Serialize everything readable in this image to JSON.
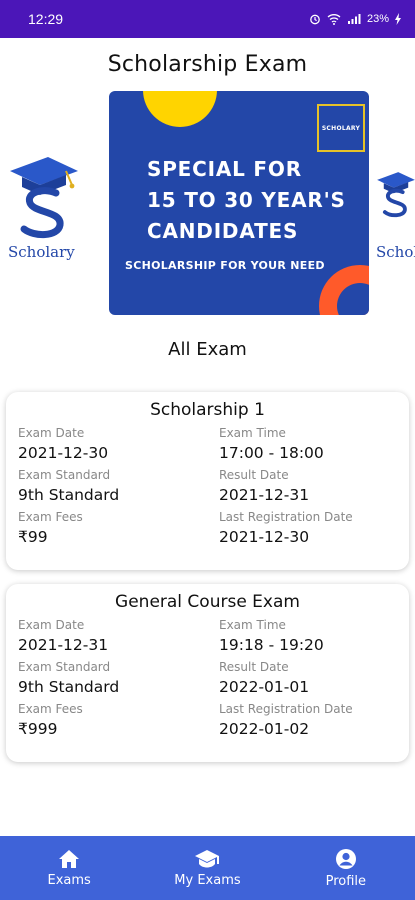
{
  "status_bar": {
    "time": "12:29",
    "battery": "23%"
  },
  "page": {
    "title": "Scholarship Exam",
    "section_title": "All Exam"
  },
  "banner": {
    "badge": "SCHOLARY",
    "line1": "SPECIAL FOR",
    "line2": "15 TO 30 YEAR'S",
    "line3": "CANDIDATES",
    "sub": "SCHOLARSHIP FOR YOUR NEED"
  },
  "logos": {
    "left_brand": "Scholary",
    "right_brand": "Schol"
  },
  "exams": [
    {
      "name": "Scholarship 1",
      "exam_date_label": "Exam Date",
      "exam_date": "2021-12-30",
      "exam_time_label": "Exam Time",
      "exam_time": "17:00 - 18:00",
      "standard_label": "Exam Standard",
      "standard": "9th Standard",
      "result_label": "Result Date",
      "result_date": "2021-12-31",
      "fees_label": "Exam Fees",
      "fees": "₹99",
      "last_reg_label": "Last Registration Date",
      "last_reg": "2021-12-30"
    },
    {
      "name": "General Course Exam",
      "exam_date_label": "Exam Date",
      "exam_date": "2021-12-31",
      "exam_time_label": "Exam Time",
      "exam_time": "19:18 - 19:20",
      "standard_label": "Exam Standard",
      "standard": "9th Standard",
      "result_label": "Result Date",
      "result_date": "2022-01-01",
      "fees_label": "Exam Fees",
      "fees": "₹999",
      "last_reg_label": "Last Registration Date",
      "last_reg": "2022-01-02"
    }
  ],
  "nav": [
    {
      "label": "Exams",
      "icon": "home-icon"
    },
    {
      "label": "My Exams",
      "icon": "graduation-cap-icon"
    },
    {
      "label": "Profile",
      "icon": "account-circle-icon"
    }
  ],
  "colors": {
    "status_bar": "#4b16b8",
    "banner": "#2347a8",
    "nav": "#3f63d8",
    "accent_yellow": "#ffd400",
    "accent_orange": "#ff5a2a"
  }
}
